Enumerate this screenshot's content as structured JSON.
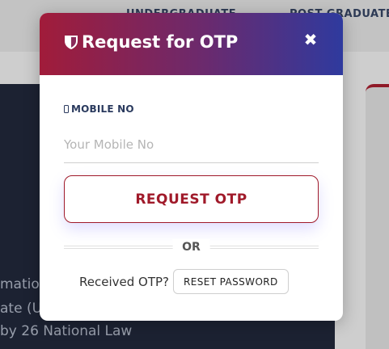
{
  "background": {
    "nav": {
      "item_ug": "UNDERGRADUATE",
      "item_pg": "POST GRADUATE"
    },
    "card": {
      "line1": "mation",
      "line2": "ate (U",
      "line3": "by 26 National Law"
    }
  },
  "modal": {
    "title": "Request for OTP",
    "title_icon": "shield-icon",
    "close_icon": "close-icon",
    "close_glyph": "✖",
    "field": {
      "label": "MOBILE NO",
      "label_icon": "phone-icon",
      "value": "",
      "placeholder": "Your Mobile No"
    },
    "request_button": "REQUEST OTP",
    "divider_text": "OR",
    "received_text": "Received OTP?",
    "reset_button": "RESET PASSWORD"
  },
  "colors": {
    "accent_red": "#a01a2a",
    "header_gradient_start": "#a11c3a",
    "header_gradient_end": "#2f3a9e",
    "label_navy": "#2a3a5e"
  }
}
